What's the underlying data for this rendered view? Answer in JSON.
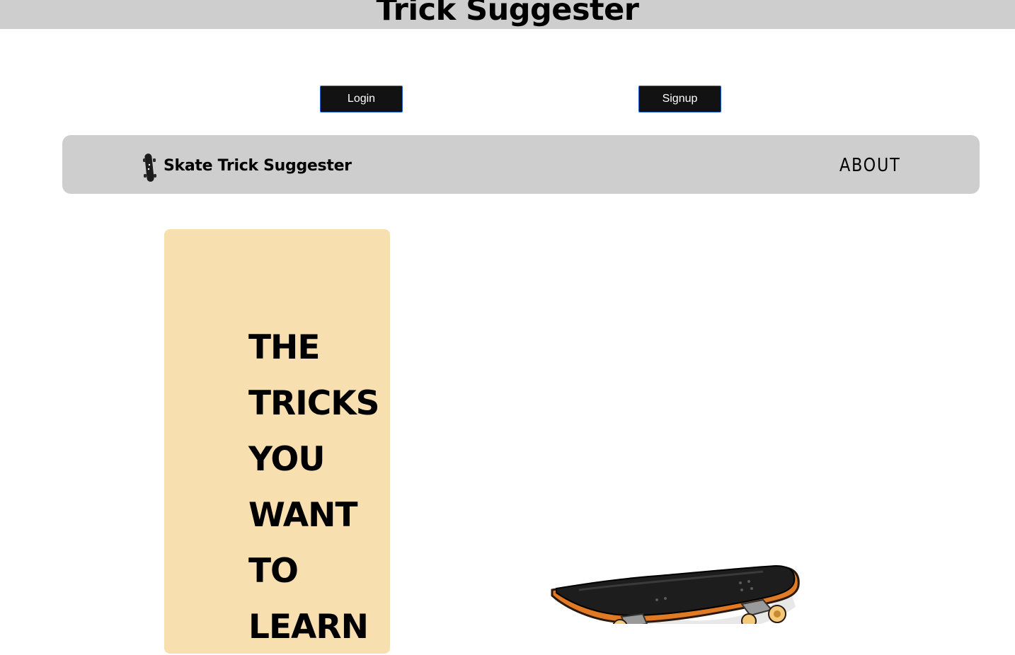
{
  "header": {
    "title": "Trick Suggester"
  },
  "auth": {
    "login_label": "Login",
    "signup_label": "Signup"
  },
  "navbar": {
    "brand_text": "Skate Trick Suggester",
    "brand_icon": "skateboard-icon",
    "about_label": "ABOUT"
  },
  "hero": {
    "headline": "THE\nTRICKS\nYOU\nWANT\nTO\nLEARN"
  },
  "illustration": {
    "name": "skateboard-illustration"
  },
  "colors": {
    "header_bg": "#cecece",
    "navbar_bg": "#cecece",
    "button_bg": "#121212",
    "button_border": "#1d5fd1",
    "hero_card_bg": "#f7dfb0"
  }
}
